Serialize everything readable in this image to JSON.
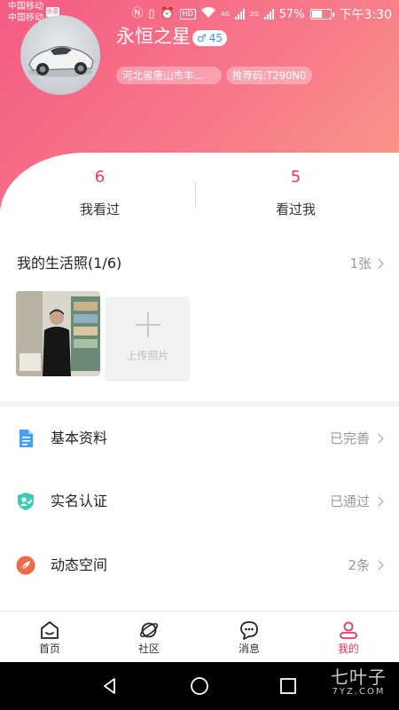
{
  "status_bar": {
    "carrier_1": "中国移动",
    "carrier_2": "中国移动",
    "badge": "头条",
    "network_1": "4G",
    "network_2": "2G",
    "hd_label": "HD",
    "battery": "57%",
    "time": "下午3:30"
  },
  "profile": {
    "nickname": "永恒之星",
    "gender_symbol": "♂",
    "age": "45",
    "location": "河北省唐山市丰...",
    "referral": "推荐码:T290N0"
  },
  "stats": {
    "viewed_count": "6",
    "viewed_label": "我看过",
    "viewers_count": "5",
    "viewers_label": "看过我"
  },
  "photos": {
    "title": "我的生活照(1/6)",
    "count": "1张",
    "upload_label": "上传照片"
  },
  "menu": [
    {
      "label": "基本资料",
      "value": "已完善",
      "icon": "document-icon",
      "color": "#4a9ff5"
    },
    {
      "label": "实名认证",
      "value": "已通过",
      "icon": "id-shield-icon",
      "color": "#3ec9b6"
    },
    {
      "label": "动态空间",
      "value": "2条",
      "icon": "feather-icon",
      "color": "#f06a4a"
    }
  ],
  "tabs": [
    {
      "label": "首页",
      "icon": "home-icon"
    },
    {
      "label": "社区",
      "icon": "planet-icon"
    },
    {
      "label": "消息",
      "icon": "chat-icon"
    },
    {
      "label": "我的",
      "icon": "user-icon"
    }
  ],
  "watermark": {
    "main": "七叶子",
    "sub": "7YZ.COM"
  },
  "colors": {
    "accent": "#e8385c",
    "header_start": "#f45b82",
    "header_end": "#fa9a86"
  }
}
